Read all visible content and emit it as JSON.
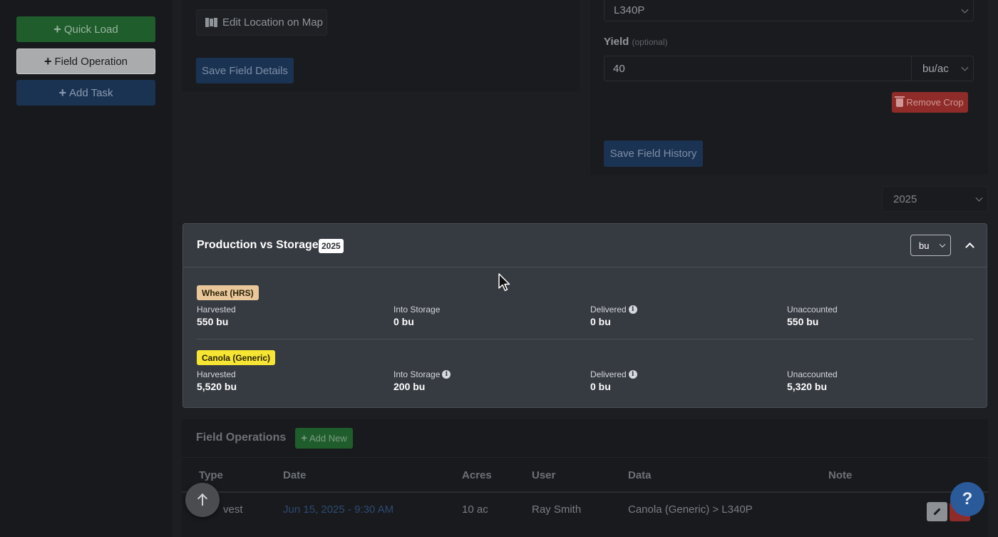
{
  "sidebar": {
    "quick_load": "Quick Load",
    "field_operation": "Field Operation",
    "add_task": "Add Task"
  },
  "field_details": {
    "edit_location": "Edit Location on Map",
    "save_button": "Save Field Details"
  },
  "field_history": {
    "variety_value": "L340P",
    "yield_label": "Yield",
    "yield_optional": "(optional)",
    "yield_value": "40",
    "yield_unit": "bu/ac",
    "remove_crop": "Remove Crop",
    "save_button": "Save Field History"
  },
  "year_selector": {
    "value": "2025"
  },
  "production_vs_storage": {
    "title": "Production vs Storage",
    "year_badge": "2025",
    "unit": "bu",
    "crops": [
      {
        "name": "Wheat (HRS)",
        "tag_color": "#e9c79a",
        "harvested_label": "Harvested",
        "harvested": "550 bu",
        "storage_label": "Into Storage",
        "storage": "0 bu",
        "delivered_label": "Delivered",
        "delivered": "0 bu",
        "unaccounted_label": "Unaccounted",
        "unaccounted": "550 bu"
      },
      {
        "name": "Canola (Generic)",
        "tag_color": "#f6e533",
        "harvested_label": "Harvested",
        "harvested": "5,520 bu",
        "storage_label": "Into Storage",
        "storage": "200 bu",
        "delivered_label": "Delivered",
        "delivered": "0 bu",
        "unaccounted_label": "Unaccounted",
        "unaccounted": "5,320 bu"
      }
    ]
  },
  "field_operations": {
    "title": "Field Operations",
    "add_new": "Add New",
    "columns": [
      "Type",
      "Date",
      "Acres",
      "User",
      "Data",
      "Note"
    ],
    "rows": [
      {
        "type": "vest",
        "date": "Jun 15, 2025 - 9:30 AM",
        "acres": "10 ac",
        "user": "Ray Smith",
        "data": "Canola (Generic) > L340P",
        "note": ""
      }
    ]
  },
  "help_label": "?"
}
